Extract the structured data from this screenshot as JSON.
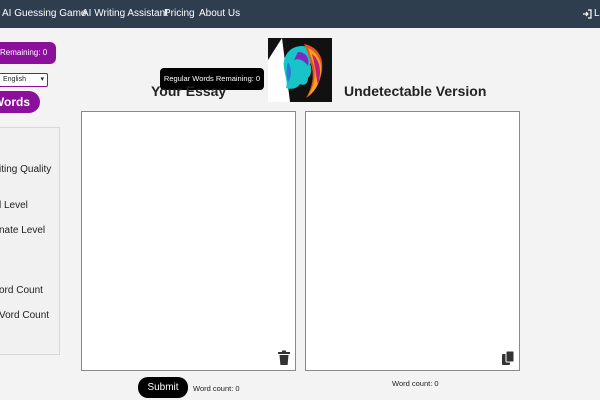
{
  "nav": {
    "links": [
      "AI Guessing Game",
      "AI Writing Assistant",
      "Pricing",
      "About Us"
    ],
    "login_partial": "L"
  },
  "sidebar": {
    "remaining_label": "Remaining: 0",
    "language_value": "English",
    "words_button_label": "Words",
    "options": [
      "iting Quality",
      "l Level",
      "nate Level",
      "ord Count",
      "Vord Count"
    ]
  },
  "tooltip": "Regular Words Remaining: 0",
  "left_panel": {
    "title": "Your Essay",
    "word_count": "Word count: 0"
  },
  "right_panel": {
    "title": "Undetectable Version",
    "word_count": "Word count: 0"
  },
  "submit_label": "Submit",
  "icons": {
    "delete": "trash-icon",
    "copy": "copy-icon",
    "login": "sign-in-icon"
  },
  "colors": {
    "nav_bg": "#2f3e4e",
    "accent": "#8b0f9a"
  }
}
